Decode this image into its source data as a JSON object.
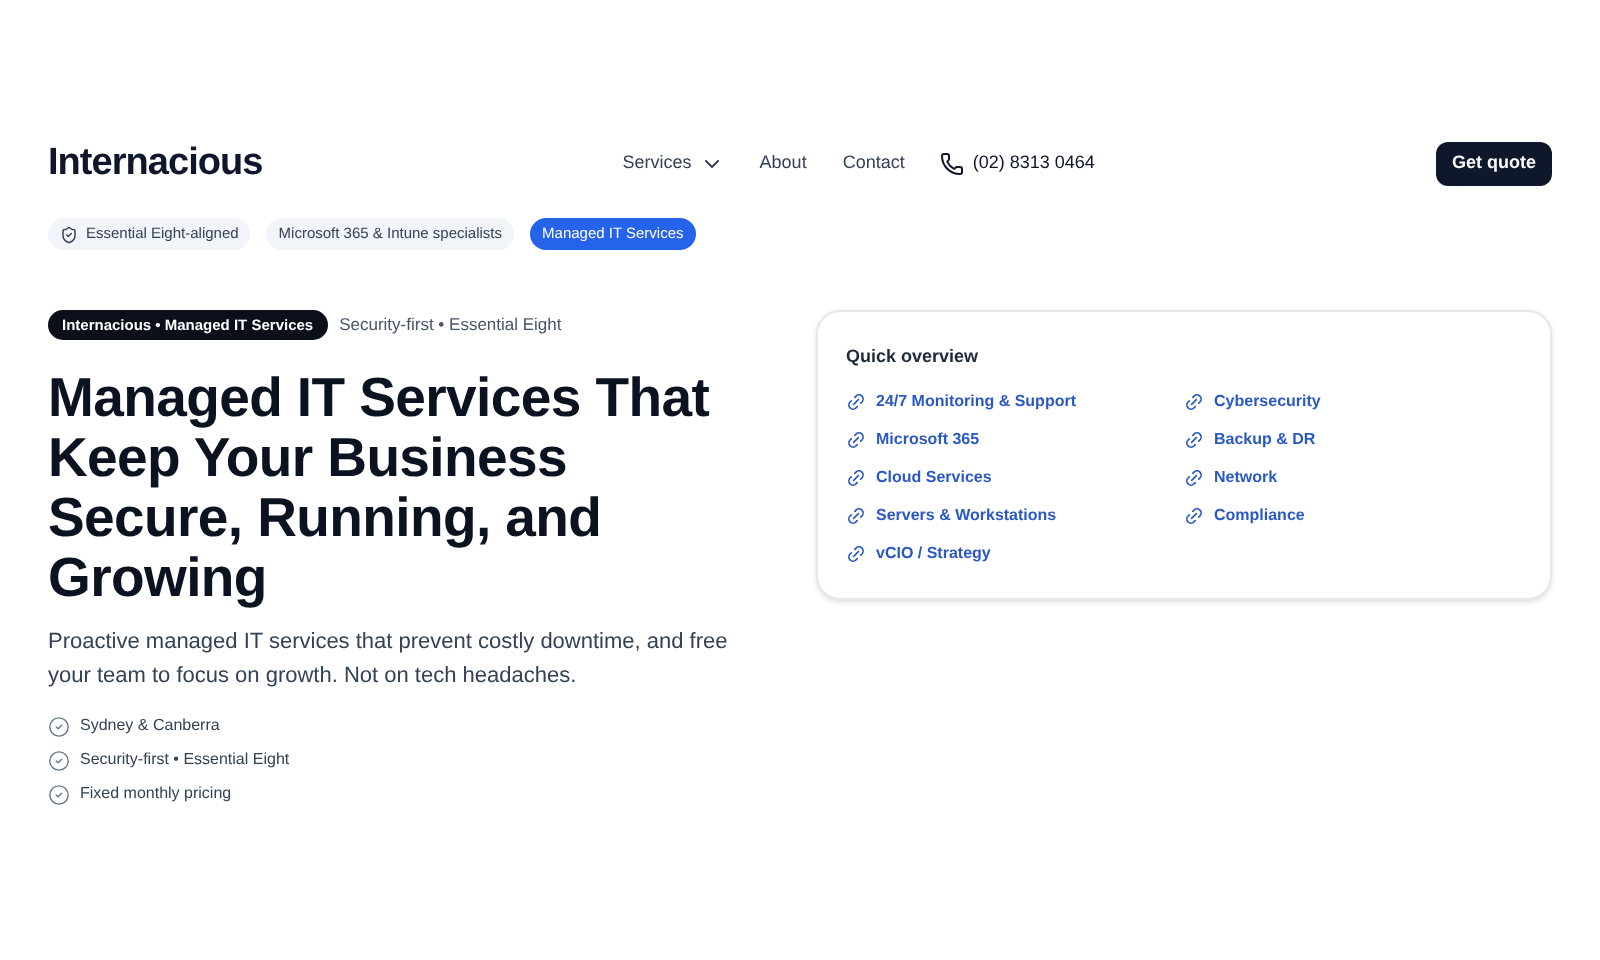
{
  "header": {
    "logo": "Internacious",
    "nav": [
      {
        "label": "Services",
        "dropdown": true
      },
      {
        "label": "About",
        "dropdown": false
      },
      {
        "label": "Contact",
        "dropdown": false
      }
    ],
    "phone": "(02) 8313 0464",
    "cta": "Get quote"
  },
  "badges": [
    {
      "label": "Essential Eight-aligned",
      "icon": true,
      "selected": false
    },
    {
      "label": "Microsoft 365 & Intune specialists",
      "icon": false,
      "selected": false
    },
    {
      "label": "Managed IT Services",
      "icon": false,
      "selected": true
    }
  ],
  "hero": {
    "tag": "Internacious • Managed IT Services",
    "tag_note": "Security-first • Essential Eight",
    "title": "Managed IT Services That Keep Your Business Secure, Running, and Growing",
    "lead": "Proactive managed IT services that prevent costly downtime, and free your team to focus on growth. Not on tech headaches.",
    "points": [
      "Sydney & Canberra",
      "Security-first • Essential Eight",
      "Fixed monthly pricing"
    ]
  },
  "overview": {
    "title": "Quick overview",
    "links": [
      "24/7 Monitoring & Support",
      "Cybersecurity",
      "Microsoft 365",
      "Backup & DR",
      "Cloud Services",
      "Network",
      "Servers & Workstations",
      "Compliance",
      "vCIO / Strategy"
    ]
  }
}
